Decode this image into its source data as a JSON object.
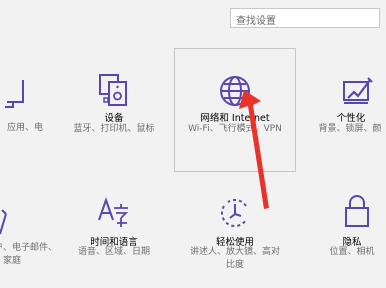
{
  "search": {
    "placeholder": "查找设置"
  },
  "accent_color": "#5b46b0",
  "tiles": [
    {
      "title": "",
      "description": "应用、电",
      "icon": "system-icon"
    },
    {
      "title": "设备",
      "description": "蓝牙、打印机、鼠标",
      "icon": "devices-icon"
    },
    {
      "title": "网络和 Internet",
      "description": "Wi-Fi、飞行模式、VPN",
      "icon": "globe-icon"
    },
    {
      "title": "个性化",
      "description": "背景、锁屏、颜",
      "icon": "personalization-icon"
    },
    {
      "title": "",
      "description": "户、电子邮件、\n、家庭",
      "icon": "accounts-icon"
    },
    {
      "title": "时间和语言",
      "description": "语音、区域、日期",
      "icon": "time-language-icon"
    },
    {
      "title": "轻松使用",
      "description": "讲述人、放大镜、高对\n比度",
      "icon": "ease-of-access-icon"
    },
    {
      "title": "隐私",
      "description": "位置、相机",
      "icon": "privacy-lock-icon"
    }
  ]
}
